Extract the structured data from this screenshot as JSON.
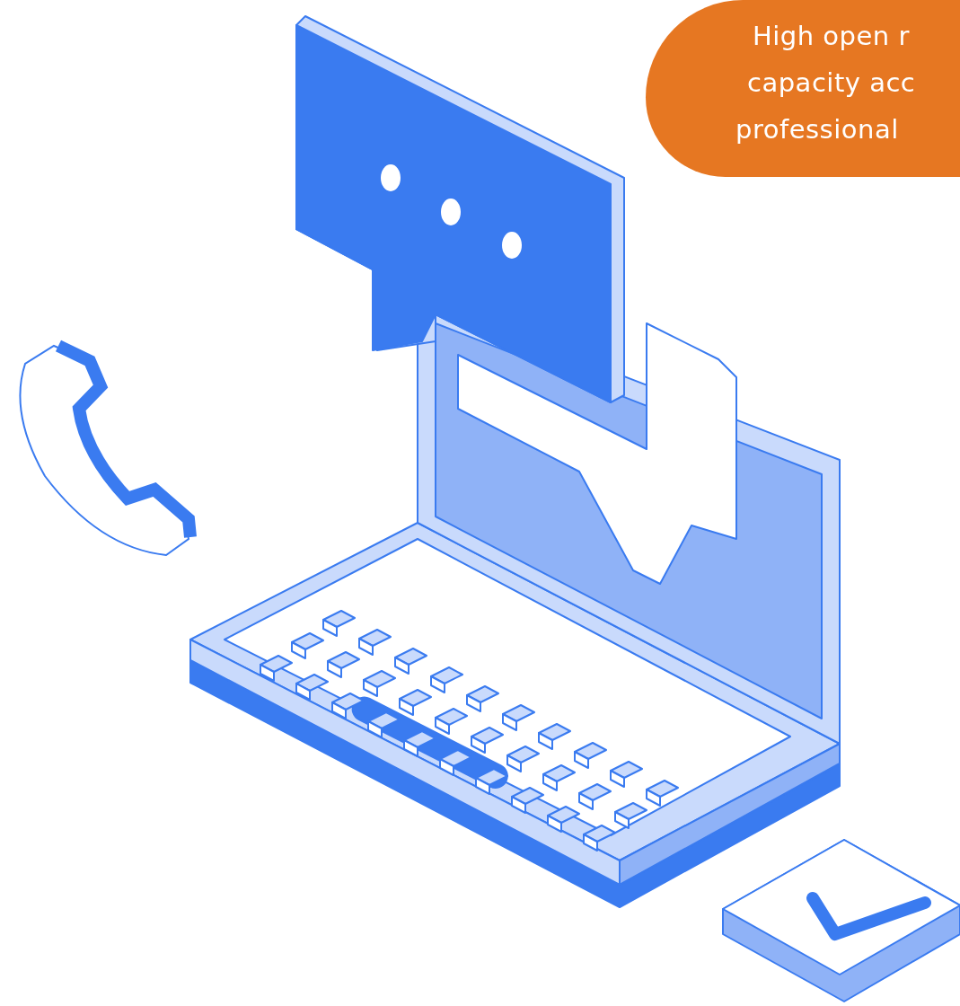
{
  "callout": {
    "lines": [
      "High open r",
      "capacity acc",
      "professional"
    ]
  }
}
